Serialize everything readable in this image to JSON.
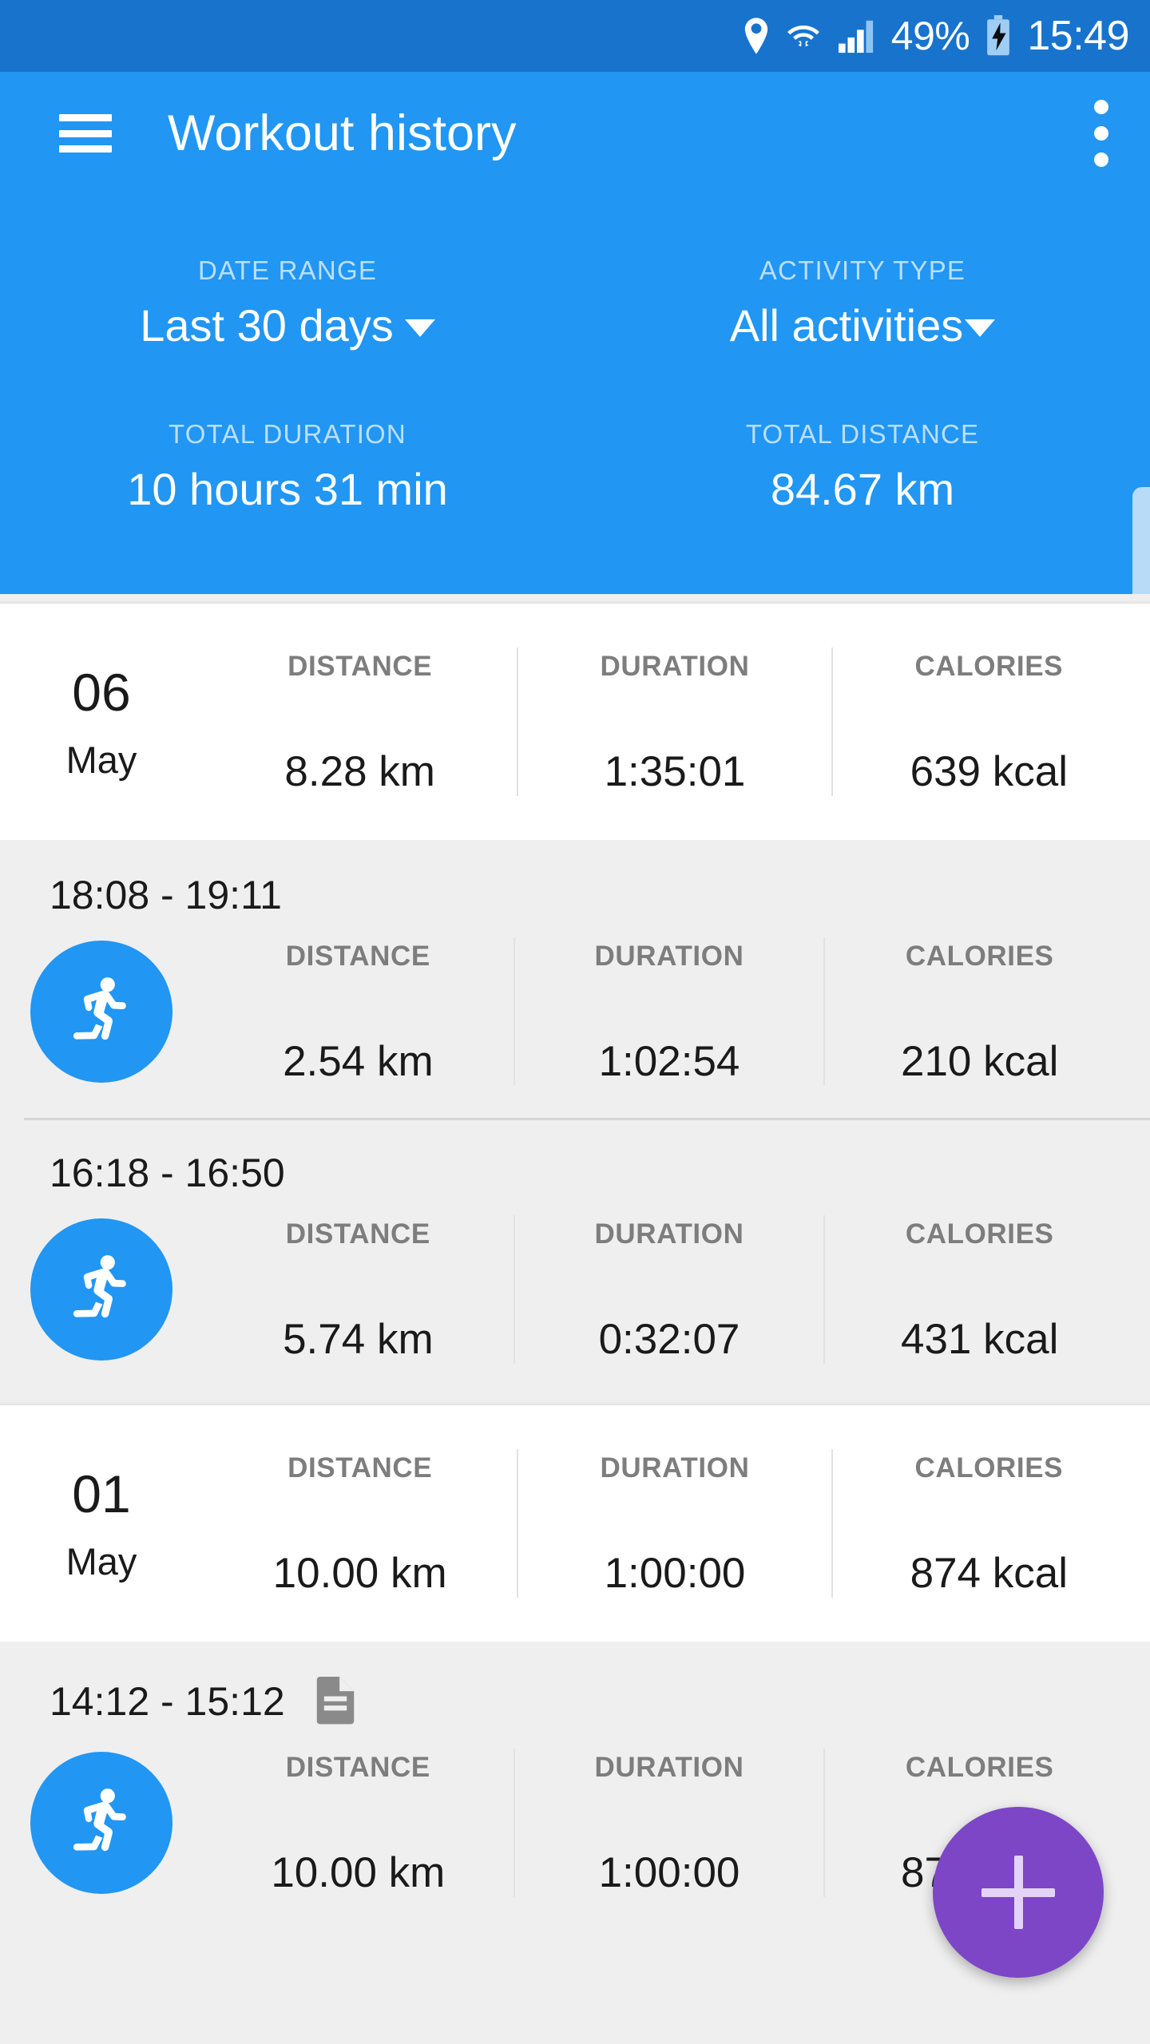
{
  "status_bar": {
    "location_icon": "location-pin-icon",
    "wifi_icon": "wifi-icon",
    "signal_icon": "cellular-signal-icon",
    "battery_percent": "49%",
    "battery_icon": "battery-charging-icon",
    "clock": "15:49"
  },
  "app_bar": {
    "menu_icon": "hamburger-menu-icon",
    "title": "Workout history",
    "overflow_icon": "overflow-menu-icon"
  },
  "summary": {
    "date_range_label": "DATE RANGE",
    "date_range_value": "Last 30 days",
    "activity_type_label": "ACTIVITY TYPE",
    "activity_type_value": "All activities",
    "total_duration_label": "TOTAL DURATION",
    "total_duration_value": "10 hours 31 min",
    "total_distance_label": "TOTAL DISTANCE",
    "total_distance_value": "84.67 km"
  },
  "columns": {
    "distance": "DISTANCE",
    "duration": "DURATION",
    "calories": "CALORIES"
  },
  "days": [
    {
      "day": "06",
      "month": "May",
      "distance": "8.28 km",
      "duration": "1:35:01",
      "calories": "639 kcal",
      "workouts": [
        {
          "time": "18:08 - 19:11",
          "sport_icon": "running-icon",
          "has_note": false,
          "distance": "2.54 km",
          "duration": "1:02:54",
          "calories": "210 kcal"
        },
        {
          "time": "16:18 - 16:50",
          "sport_icon": "running-icon",
          "has_note": false,
          "distance": "5.74 km",
          "duration": "0:32:07",
          "calories": "431 kcal"
        }
      ]
    },
    {
      "day": "01",
      "month": "May",
      "distance": "10.00 km",
      "duration": "1:00:00",
      "calories": "874 kcal",
      "workouts": [
        {
          "time": "14:12 - 15:12",
          "sport_icon": "running-icon",
          "has_note": true,
          "note_icon": "note-document-icon",
          "distance": "10.00 km",
          "duration": "1:00:00",
          "calories": "875 kcal"
        }
      ]
    }
  ],
  "fab": {
    "icon": "plus-icon",
    "label": "Add workout"
  },
  "colors": {
    "status_bar": "#1873cd",
    "app_bar": "#2196f3",
    "accent": "#2196f3",
    "fab": "#7d46c6",
    "background": "#efefef",
    "card": "#ffffff"
  }
}
